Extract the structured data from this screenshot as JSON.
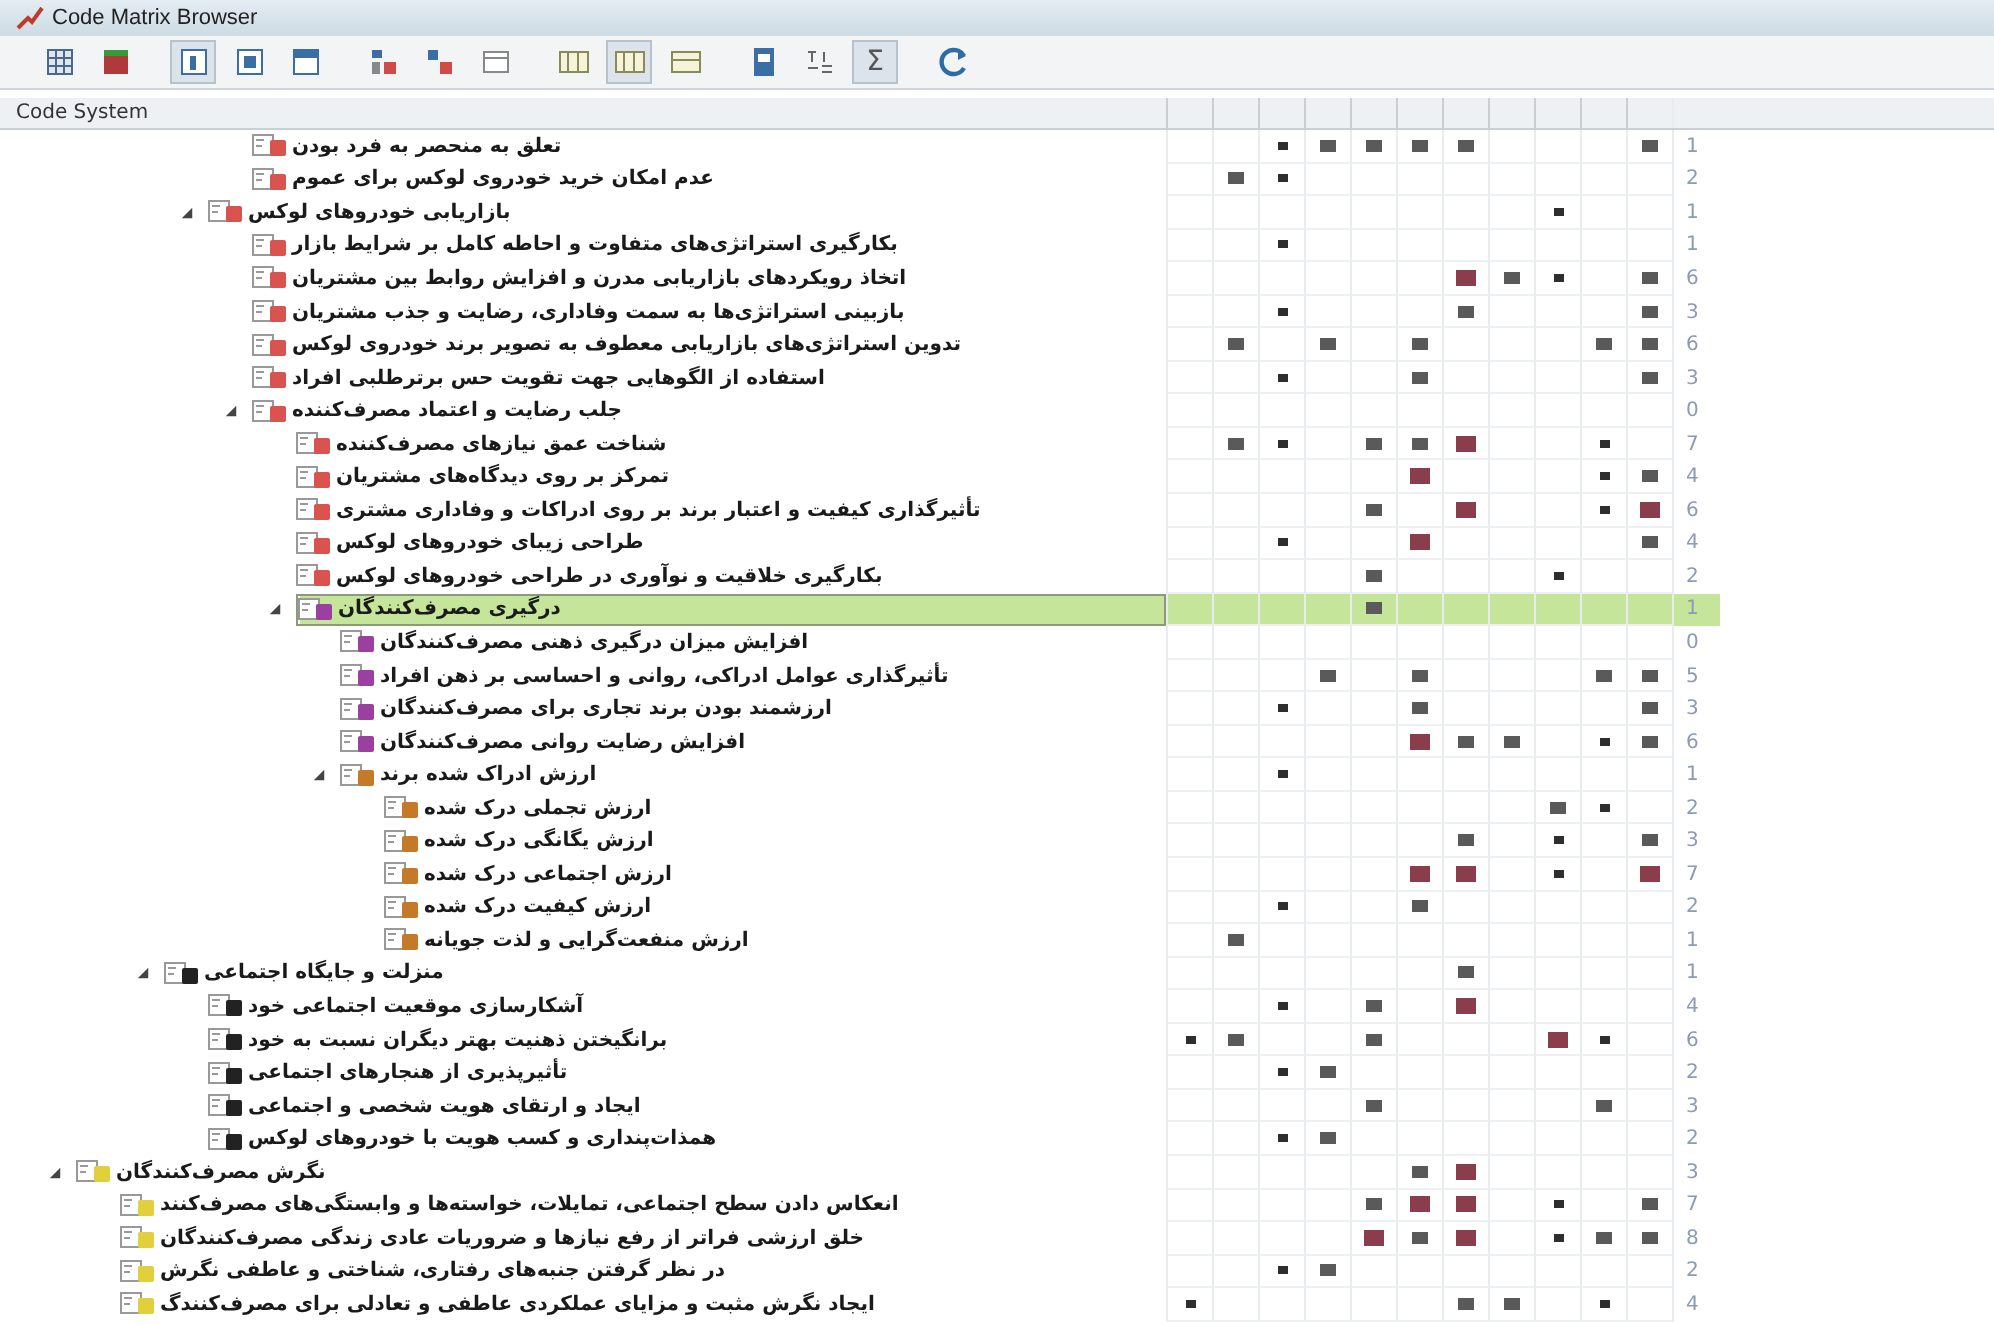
{
  "window": {
    "title": "Code Matrix Browser"
  },
  "toolbar": [
    [
      {
        "kind": "matrix",
        "pressed": false
      },
      {
        "kind": "table",
        "pressed": false
      }
    ],
    [
      {
        "kind": "frame-left",
        "pressed": true
      },
      {
        "kind": "frame-center",
        "pressed": false
      },
      {
        "kind": "frame-top",
        "pressed": false
      }
    ],
    [
      {
        "kind": "tags-vertical",
        "pressed": false
      },
      {
        "kind": "tags-horizontal",
        "pressed": false
      },
      {
        "kind": "window-blank",
        "pressed": false
      }
    ],
    [
      {
        "kind": "columns-a",
        "pressed": false
      },
      {
        "kind": "columns-b",
        "pressed": true
      },
      {
        "kind": "columns-c",
        "pressed": false
      }
    ],
    [
      {
        "kind": "document",
        "pressed": false
      },
      {
        "kind": "symbols",
        "pressed": false
      },
      {
        "kind": "sigma",
        "pressed": true,
        "glyph": "Σ"
      }
    ],
    [
      {
        "kind": "refresh",
        "pressed": false
      }
    ]
  ],
  "code_system": {
    "header": "Code System",
    "continued_children": [
      {
        "label": "تعلق به منحصر به فرد بودن",
        "color": "#d9534f",
        "count": "1",
        "selected": false,
        "cells": [
          {
            "kind": "empty"
          },
          {
            "kind": "empty"
          },
          {
            "kind": "small"
          },
          {
            "kind": "medium"
          },
          {
            "kind": "medium"
          },
          {
            "kind": "medium"
          },
          {
            "kind": "medium"
          },
          {
            "kind": "empty"
          },
          {
            "kind": "empty"
          },
          {
            "kind": "empty"
          },
          {
            "kind": "medium"
          }
        ]
      },
      {
        "label": "عدم امکان خرید خودروی لوکس برای عموم",
        "color": "#d9534f",
        "count": "2",
        "selected": false,
        "cells": [
          {
            "kind": "empty"
          },
          {
            "kind": "medium"
          },
          {
            "kind": "small"
          },
          {
            "kind": "empty"
          },
          {
            "kind": "empty"
          },
          {
            "kind": "empty"
          },
          {
            "kind": "empty"
          },
          {
            "kind": "empty"
          },
          {
            "kind": "empty"
          },
          {
            "kind": "empty"
          },
          {
            "kind": "empty"
          }
        ]
      }
    ],
    "continued_groups": [
      {
        "label": "بازاریابی خودروهای لوکس",
        "color": "#d9534f",
        "count": "1",
        "selected": false,
        "expanded": true,
        "cells": [
          {
            "kind": "empty"
          },
          {
            "kind": "empty"
          },
          {
            "kind": "empty"
          },
          {
            "kind": "empty"
          },
          {
            "kind": "empty"
          },
          {
            "kind": "empty"
          },
          {
            "kind": "empty"
          },
          {
            "kind": "empty"
          },
          {
            "kind": "small"
          },
          {
            "kind": "empty"
          },
          {
            "kind": "empty"
          }
        ],
        "children": [
          {
            "label": "بکارگیری استراتژی‌های متفاوت و احاطه کامل بر شرایط بازار",
            "color": "#d9534f",
            "count": "1",
            "selected": false,
            "cells": [
              {
                "kind": "empty"
              },
              {
                "kind": "empty"
              },
              {
                "kind": "small"
              },
              {
                "kind": "empty"
              },
              {
                "kind": "empty"
              },
              {
                "kind": "empty"
              },
              {
                "kind": "empty"
              },
              {
                "kind": "empty"
              },
              {
                "kind": "empty"
              },
              {
                "kind": "empty"
              },
              {
                "kind": "empty"
              }
            ]
          },
          {
            "label": "اتخاذ رویکردهای بازاریابی مدرن و افزایش روابط بین مشتریان",
            "color": "#d9534f",
            "count": "6",
            "selected": false,
            "cells": [
              {
                "kind": "empty"
              },
              {
                "kind": "empty"
              },
              {
                "kind": "empty"
              },
              {
                "kind": "empty"
              },
              {
                "kind": "empty"
              },
              {
                "kind": "empty"
              },
              {
                "kind": "large"
              },
              {
                "kind": "medium"
              },
              {
                "kind": "small"
              },
              {
                "kind": "empty"
              },
              {
                "kind": "medium"
              }
            ]
          },
          {
            "label": "بازبینی استراتژی‌ها به سمت وفاداری، رضایت و جذب مشتریان",
            "color": "#d9534f",
            "count": "3",
            "selected": false,
            "cells": [
              {
                "kind": "empty"
              },
              {
                "kind": "empty"
              },
              {
                "kind": "small"
              },
              {
                "kind": "empty"
              },
              {
                "kind": "empty"
              },
              {
                "kind": "empty"
              },
              {
                "kind": "medium"
              },
              {
                "kind": "empty"
              },
              {
                "kind": "empty"
              },
              {
                "kind": "empty"
              },
              {
                "kind": "medium"
              }
            ]
          },
          {
            "label": "تدوین استراتژی‌های بازاریابی معطوف به تصویر برند خودروی لوکس",
            "color": "#d9534f",
            "count": "6",
            "selected": false,
            "cells": [
              {
                "kind": "empty"
              },
              {
                "kind": "medium"
              },
              {
                "kind": "empty"
              },
              {
                "kind": "medium"
              },
              {
                "kind": "empty"
              },
              {
                "kind": "medium"
              },
              {
                "kind": "empty"
              },
              {
                "kind": "empty"
              },
              {
                "kind": "empty"
              },
              {
                "kind": "medium"
              },
              {
                "kind": "medium"
              }
            ]
          },
          {
            "label": "استفاده از الگوهایی جهت تقویت حس برترطلبی افراد",
            "color": "#d9534f",
            "count": "3",
            "selected": false,
            "cells": [
              {
                "kind": "empty"
              },
              {
                "kind": "empty"
              },
              {
                "kind": "small"
              },
              {
                "kind": "empty"
              },
              {
                "kind": "empty"
              },
              {
                "kind": "medium"
              },
              {
                "kind": "empty"
              },
              {
                "kind": "empty"
              },
              {
                "kind": "empty"
              },
              {
                "kind": "empty"
              },
              {
                "kind": "medium"
              }
            ]
          },
          {
            "label": "جلب رضایت و اعتماد مصرف‌کننده",
            "color": "#d9534f",
            "count": "0",
            "selected": false,
            "expanded": true,
            "cells": [
              {
                "kind": "empty"
              },
              {
                "kind": "empty"
              },
              {
                "kind": "empty"
              },
              {
                "kind": "empty"
              },
              {
                "kind": "empty"
              },
              {
                "kind": "empty"
              },
              {
                "kind": "empty"
              },
              {
                "kind": "empty"
              },
              {
                "kind": "empty"
              },
              {
                "kind": "empty"
              },
              {
                "kind": "empty"
              }
            ],
            "children": [
              {
                "label": "شناخت عمق نیازهای مصرف‌کننده",
                "color": "#d9534f",
                "count": "7",
                "selected": false,
                "cells": [
                  {
                    "kind": "empty"
                  },
                  {
                    "kind": "medium"
                  },
                  {
                    "kind": "small"
                  },
                  {
                    "kind": "empty"
                  },
                  {
                    "kind": "medium"
                  },
                  {
                    "kind": "medium"
                  },
                  {
                    "kind": "large"
                  },
                  {
                    "kind": "empty"
                  },
                  {
                    "kind": "empty"
                  },
                  {
                    "kind": "small"
                  },
                  {
                    "kind": "empty"
                  }
                ]
              },
              {
                "label": "تمرکز بر روی دیدگاه‌های مشتریان",
                "color": "#d9534f",
                "count": "4",
                "selected": false,
                "cells": [
                  {
                    "kind": "empty"
                  },
                  {
                    "kind": "empty"
                  },
                  {
                    "kind": "empty"
                  },
                  {
                    "kind": "empty"
                  },
                  {
                    "kind": "empty"
                  },
                  {
                    "kind": "large"
                  },
                  {
                    "kind": "empty"
                  },
                  {
                    "kind": "empty"
                  },
                  {
                    "kind": "empty"
                  },
                  {
                    "kind": "small"
                  },
                  {
                    "kind": "medium"
                  }
                ]
              },
              {
                "label": "تأثیرگذاری کیفیت و اعتبار برند بر روی ادراکات و وفاداری مشتری",
                "color": "#d9534f",
                "count": "6",
                "selected": false,
                "cells": [
                  {
                    "kind": "empty"
                  },
                  {
                    "kind": "empty"
                  },
                  {
                    "kind": "empty"
                  },
                  {
                    "kind": "empty"
                  },
                  {
                    "kind": "medium"
                  },
                  {
                    "kind": "empty"
                  },
                  {
                    "kind": "large"
                  },
                  {
                    "kind": "empty"
                  },
                  {
                    "kind": "empty"
                  },
                  {
                    "kind": "small"
                  },
                  {
                    "kind": "large"
                  }
                ]
              },
              {
                "label": "طراحی زیبای خودروهای لوکس",
                "color": "#d9534f",
                "count": "4",
                "selected": false,
                "cells": [
                  {
                    "kind": "empty"
                  },
                  {
                    "kind": "empty"
                  },
                  {
                    "kind": "small"
                  },
                  {
                    "kind": "empty"
                  },
                  {
                    "kind": "empty"
                  },
                  {
                    "kind": "large"
                  },
                  {
                    "kind": "empty"
                  },
                  {
                    "kind": "empty"
                  },
                  {
                    "kind": "empty"
                  },
                  {
                    "kind": "empty"
                  },
                  {
                    "kind": "medium"
                  }
                ]
              },
              {
                "label": "بکارگیری خلاقیت و نوآوری در طراحی خودروهای لوکس",
                "color": "#d9534f",
                "count": "2",
                "selected": false,
                "cells": [
                  {
                    "kind": "empty"
                  },
                  {
                    "kind": "empty"
                  },
                  {
                    "kind": "empty"
                  },
                  {
                    "kind": "empty"
                  },
                  {
                    "kind": "medium"
                  },
                  {
                    "kind": "empty"
                  },
                  {
                    "kind": "empty"
                  },
                  {
                    "kind": "empty"
                  },
                  {
                    "kind": "small"
                  },
                  {
                    "kind": "empty"
                  },
                  {
                    "kind": "empty"
                  }
                ]
              },
              {
                "label": "درگیری مصرف‌کنندگان",
                "color": "#9b3fa0",
                "count": "1",
                "selected": true,
                "expanded": true,
                "cells": [
                  {
                    "kind": "empty"
                  },
                  {
                    "kind": "empty"
                  },
                  {
                    "kind": "empty"
                  },
                  {
                    "kind": "empty"
                  },
                  {
                    "kind": "medium"
                  },
                  {
                    "kind": "empty"
                  },
                  {
                    "kind": "empty"
                  },
                  {
                    "kind": "empty"
                  },
                  {
                    "kind": "empty"
                  },
                  {
                    "kind": "empty"
                  },
                  {
                    "kind": "empty"
                  }
                ],
                "children": [
                  {
                    "label": "افزایش میزان درگیری ذهنی مصرف‌کنندگان",
                    "color": "#9b3fa0",
                    "count": "0",
                    "selected": false,
                    "cells": [
                      {
                        "kind": "empty"
                      },
                      {
                        "kind": "empty"
                      },
                      {
                        "kind": "empty"
                      },
                      {
                        "kind": "empty"
                      },
                      {
                        "kind": "empty"
                      },
                      {
                        "kind": "empty"
                      },
                      {
                        "kind": "empty"
                      },
                      {
                        "kind": "empty"
                      },
                      {
                        "kind": "empty"
                      },
                      {
                        "kind": "empty"
                      },
                      {
                        "kind": "empty"
                      }
                    ]
                  },
                  {
                    "label": "تأثیرگذاری عوامل ادراکی، روانی و احساسی بر ذهن افراد",
                    "color": "#9b3fa0",
                    "count": "5",
                    "selected": false,
                    "cells": [
                      {
                        "kind": "empty"
                      },
                      {
                        "kind": "empty"
                      },
                      {
                        "kind": "empty"
                      },
                      {
                        "kind": "medium"
                      },
                      {
                        "kind": "empty"
                      },
                      {
                        "kind": "medium"
                      },
                      {
                        "kind": "empty"
                      },
                      {
                        "kind": "empty"
                      },
                      {
                        "kind": "empty"
                      },
                      {
                        "kind": "medium"
                      },
                      {
                        "kind": "medium"
                      }
                    ]
                  },
                  {
                    "label": "ارزشمند بودن برند تجاری برای مصرف‌کنندگان",
                    "color": "#9b3fa0",
                    "count": "3",
                    "selected": false,
                    "cells": [
                      {
                        "kind": "empty"
                      },
                      {
                        "kind": "empty"
                      },
                      {
                        "kind": "small"
                      },
                      {
                        "kind": "empty"
                      },
                      {
                        "kind": "empty"
                      },
                      {
                        "kind": "medium"
                      },
                      {
                        "kind": "empty"
                      },
                      {
                        "kind": "empty"
                      },
                      {
                        "kind": "empty"
                      },
                      {
                        "kind": "empty"
                      },
                      {
                        "kind": "medium"
                      }
                    ]
                  },
                  {
                    "label": "افزایش رضایت روانی مصرف‌کنندگان",
                    "color": "#9b3fa0",
                    "count": "6",
                    "selected": false,
                    "cells": [
                      {
                        "kind": "empty"
                      },
                      {
                        "kind": "empty"
                      },
                      {
                        "kind": "empty"
                      },
                      {
                        "kind": "empty"
                      },
                      {
                        "kind": "empty"
                      },
                      {
                        "kind": "large"
                      },
                      {
                        "kind": "medium"
                      },
                      {
                        "kind": "medium"
                      },
                      {
                        "kind": "empty"
                      },
                      {
                        "kind": "small"
                      },
                      {
                        "kind": "medium"
                      }
                    ]
                  },
                  {
                    "label": "ارزش ادراک شده برند",
                    "color": "#c57a2a",
                    "count": "1",
                    "selected": false,
                    "expanded": true,
                    "cells": [
                      {
                        "kind": "empty"
                      },
                      {
                        "kind": "empty"
                      },
                      {
                        "kind": "small"
                      },
                      {
                        "kind": "empty"
                      },
                      {
                        "kind": "empty"
                      },
                      {
                        "kind": "empty"
                      },
                      {
                        "kind": "empty"
                      },
                      {
                        "kind": "empty"
                      },
                      {
                        "kind": "empty"
                      },
                      {
                        "kind": "empty"
                      },
                      {
                        "kind": "empty"
                      }
                    ],
                    "children": [
                      {
                        "label": "ارزش تجملی درک شده",
                        "color": "#c57a2a",
                        "count": "2",
                        "selected": false,
                        "cells": [
                          {
                            "kind": "empty"
                          },
                          {
                            "kind": "empty"
                          },
                          {
                            "kind": "empty"
                          },
                          {
                            "kind": "empty"
                          },
                          {
                            "kind": "empty"
                          },
                          {
                            "kind": "empty"
                          },
                          {
                            "kind": "empty"
                          },
                          {
                            "kind": "empty"
                          },
                          {
                            "kind": "medium"
                          },
                          {
                            "kind": "small"
                          },
                          {
                            "kind": "empty"
                          }
                        ]
                      },
                      {
                        "label": "ارزش یگانگی درک شده",
                        "color": "#c57a2a",
                        "count": "3",
                        "selected": false,
                        "cells": [
                          {
                            "kind": "empty"
                          },
                          {
                            "kind": "empty"
                          },
                          {
                            "kind": "empty"
                          },
                          {
                            "kind": "empty"
                          },
                          {
                            "kind": "empty"
                          },
                          {
                            "kind": "empty"
                          },
                          {
                            "kind": "medium"
                          },
                          {
                            "kind": "empty"
                          },
                          {
                            "kind": "small"
                          },
                          {
                            "kind": "empty"
                          },
                          {
                            "kind": "medium"
                          }
                        ]
                      },
                      {
                        "label": "ارزش اجتماعی درک شده",
                        "color": "#c57a2a",
                        "count": "7",
                        "selected": false,
                        "cells": [
                          {
                            "kind": "empty"
                          },
                          {
                            "kind": "empty"
                          },
                          {
                            "kind": "empty"
                          },
                          {
                            "kind": "empty"
                          },
                          {
                            "kind": "empty"
                          },
                          {
                            "kind": "large"
                          },
                          {
                            "kind": "large"
                          },
                          {
                            "kind": "empty"
                          },
                          {
                            "kind": "small"
                          },
                          {
                            "kind": "empty"
                          },
                          {
                            "kind": "large"
                          }
                        ]
                      },
                      {
                        "label": "ارزش کیفیت درک شده",
                        "color": "#c57a2a",
                        "count": "2",
                        "selected": false,
                        "cells": [
                          {
                            "kind": "empty"
                          },
                          {
                            "kind": "empty"
                          },
                          {
                            "kind": "small"
                          },
                          {
                            "kind": "empty"
                          },
                          {
                            "kind": "empty"
                          },
                          {
                            "kind": "medium"
                          },
                          {
                            "kind": "empty"
                          },
                          {
                            "kind": "empty"
                          },
                          {
                            "kind": "empty"
                          },
                          {
                            "kind": "empty"
                          },
                          {
                            "kind": "empty"
                          }
                        ]
                      },
                      {
                        "label": "ارزش منفعت‌گرایی و لذت جویانه",
                        "color": "#c57a2a",
                        "count": "1",
                        "selected": false,
                        "cells": [
                          {
                            "kind": "empty"
                          },
                          {
                            "kind": "medium"
                          },
                          {
                            "kind": "empty"
                          },
                          {
                            "kind": "empty"
                          },
                          {
                            "kind": "empty"
                          },
                          {
                            "kind": "empty"
                          },
                          {
                            "kind": "empty"
                          },
                          {
                            "kind": "empty"
                          },
                          {
                            "kind": "empty"
                          },
                          {
                            "kind": "empty"
                          },
                          {
                            "kind": "empty"
                          }
                        ]
                      }
                    ]
                  }
                ]
              }
            ]
          }
        ]
      }
    ],
    "outer_groups": [
      {
        "label": "منزلت و جایگاه اجتماعی",
        "color": "#222222",
        "count": "1",
        "selected": false,
        "expanded": true,
        "cells": [
          {
            "kind": "empty"
          },
          {
            "kind": "empty"
          },
          {
            "kind": "empty"
          },
          {
            "kind": "empty"
          },
          {
            "kind": "empty"
          },
          {
            "kind": "empty"
          },
          {
            "kind": "medium"
          },
          {
            "kind": "empty"
          },
          {
            "kind": "empty"
          },
          {
            "kind": "empty"
          },
          {
            "kind": "empty"
          }
        ],
        "children": [
          {
            "label": "آشکارسازی موقعیت اجتماعی خود",
            "color": "#222222",
            "count": "4",
            "selected": false,
            "cells": [
              {
                "kind": "empty"
              },
              {
                "kind": "empty"
              },
              {
                "kind": "small"
              },
              {
                "kind": "empty"
              },
              {
                "kind": "medium"
              },
              {
                "kind": "empty"
              },
              {
                "kind": "large"
              },
              {
                "kind": "empty"
              },
              {
                "kind": "empty"
              },
              {
                "kind": "empty"
              },
              {
                "kind": "empty"
              }
            ]
          },
          {
            "label": "برانگیختن ذهنیت بهتر دیگران نسبت به خود",
            "color": "#222222",
            "count": "6",
            "selected": false,
            "cells": [
              {
                "kind": "small"
              },
              {
                "kind": "medium"
              },
              {
                "kind": "empty"
              },
              {
                "kind": "empty"
              },
              {
                "kind": "medium"
              },
              {
                "kind": "empty"
              },
              {
                "kind": "empty"
              },
              {
                "kind": "empty"
              },
              {
                "kind": "large"
              },
              {
                "kind": "small"
              },
              {
                "kind": "empty"
              }
            ]
          },
          {
            "label": "تأثیرپذیری از هنجارهای اجتماعی",
            "color": "#222222",
            "count": "2",
            "selected": false,
            "cells": [
              {
                "kind": "empty"
              },
              {
                "kind": "empty"
              },
              {
                "kind": "small"
              },
              {
                "kind": "medium"
              },
              {
                "kind": "empty"
              },
              {
                "kind": "empty"
              },
              {
                "kind": "empty"
              },
              {
                "kind": "empty"
              },
              {
                "kind": "empty"
              },
              {
                "kind": "empty"
              },
              {
                "kind": "empty"
              }
            ]
          },
          {
            "label": "ایجاد و ارتقای هویت شخصی و اجتماعی",
            "color": "#222222",
            "count": "3",
            "selected": false,
            "cells": [
              {
                "kind": "empty"
              },
              {
                "kind": "empty"
              },
              {
                "kind": "empty"
              },
              {
                "kind": "empty"
              },
              {
                "kind": "medium"
              },
              {
                "kind": "empty"
              },
              {
                "kind": "empty"
              },
              {
                "kind": "empty"
              },
              {
                "kind": "empty"
              },
              {
                "kind": "medium"
              },
              {
                "kind": "empty"
              }
            ]
          },
          {
            "label": "همذات‌پنداری و کسب هویت با خودروهای لوکس",
            "color": "#222222",
            "count": "2",
            "selected": false,
            "cells": [
              {
                "kind": "empty"
              },
              {
                "kind": "empty"
              },
              {
                "kind": "small"
              },
              {
                "kind": "medium"
              },
              {
                "kind": "empty"
              },
              {
                "kind": "empty"
              },
              {
                "kind": "empty"
              },
              {
                "kind": "empty"
              },
              {
                "kind": "empty"
              },
              {
                "kind": "empty"
              },
              {
                "kind": "empty"
              }
            ]
          }
        ]
      }
    ],
    "codes": [
      {
        "label": "نگرش مصرف‌کنندگان",
        "color": "#e2cf3c",
        "count": "3",
        "selected": false,
        "expanded": true,
        "cells": [
          {
            "kind": "empty"
          },
          {
            "kind": "empty"
          },
          {
            "kind": "empty"
          },
          {
            "kind": "empty"
          },
          {
            "kind": "empty"
          },
          {
            "kind": "medium"
          },
          {
            "kind": "large"
          },
          {
            "kind": "empty"
          },
          {
            "kind": "empty"
          },
          {
            "kind": "empty"
          },
          {
            "kind": "empty"
          }
        ],
        "children": [
          {
            "label": "انعکاس دادن سطح اجتماعی، تمایلات، خواسته‌ها و وابستگی‌های مصرف‌کنند",
            "color": "#e2cf3c",
            "count": "7",
            "selected": false,
            "cells": [
              {
                "kind": "empty"
              },
              {
                "kind": "empty"
              },
              {
                "kind": "empty"
              },
              {
                "kind": "empty"
              },
              {
                "kind": "medium"
              },
              {
                "kind": "large"
              },
              {
                "kind": "large"
              },
              {
                "kind": "empty"
              },
              {
                "kind": "small"
              },
              {
                "kind": "empty"
              },
              {
                "kind": "medium"
              }
            ]
          },
          {
            "label": "خلق ارزشی فراتر از رفع نیازها و ضروریات عادی زندگی مصرف‌کنندگان",
            "color": "#e2cf3c",
            "count": "8",
            "selected": false,
            "cells": [
              {
                "kind": "empty"
              },
              {
                "kind": "empty"
              },
              {
                "kind": "empty"
              },
              {
                "kind": "empty"
              },
              {
                "kind": "large"
              },
              {
                "kind": "medium"
              },
              {
                "kind": "large"
              },
              {
                "kind": "empty"
              },
              {
                "kind": "small"
              },
              {
                "kind": "medium"
              },
              {
                "kind": "medium"
              }
            ]
          },
          {
            "label": "در نظر گرفتن جنبه‌های رفتاری، شناختی و عاطفی نگرش",
            "color": "#e2cf3c",
            "count": "2",
            "selected": false,
            "cells": [
              {
                "kind": "empty"
              },
              {
                "kind": "empty"
              },
              {
                "kind": "small"
              },
              {
                "kind": "medium"
              },
              {
                "kind": "empty"
              },
              {
                "kind": "empty"
              },
              {
                "kind": "empty"
              },
              {
                "kind": "empty"
              },
              {
                "kind": "empty"
              },
              {
                "kind": "empty"
              },
              {
                "kind": "empty"
              }
            ]
          },
          {
            "label": "ایجاد نگرش مثبت و مزایای عملکردی عاطفی و تعادلی برای مصرف‌کنندگ",
            "color": "#e2cf3c",
            "count": "4",
            "selected": false,
            "cells": [
              {
                "kind": "small"
              },
              {
                "kind": "empty"
              },
              {
                "kind": "empty"
              },
              {
                "kind": "empty"
              },
              {
                "kind": "empty"
              },
              {
                "kind": "empty"
              },
              {
                "kind": "medium"
              },
              {
                "kind": "medium"
              },
              {
                "kind": "empty"
              },
              {
                "kind": "small"
              },
              {
                "kind": "empty"
              }
            ]
          }
        ]
      }
    ]
  }
}
